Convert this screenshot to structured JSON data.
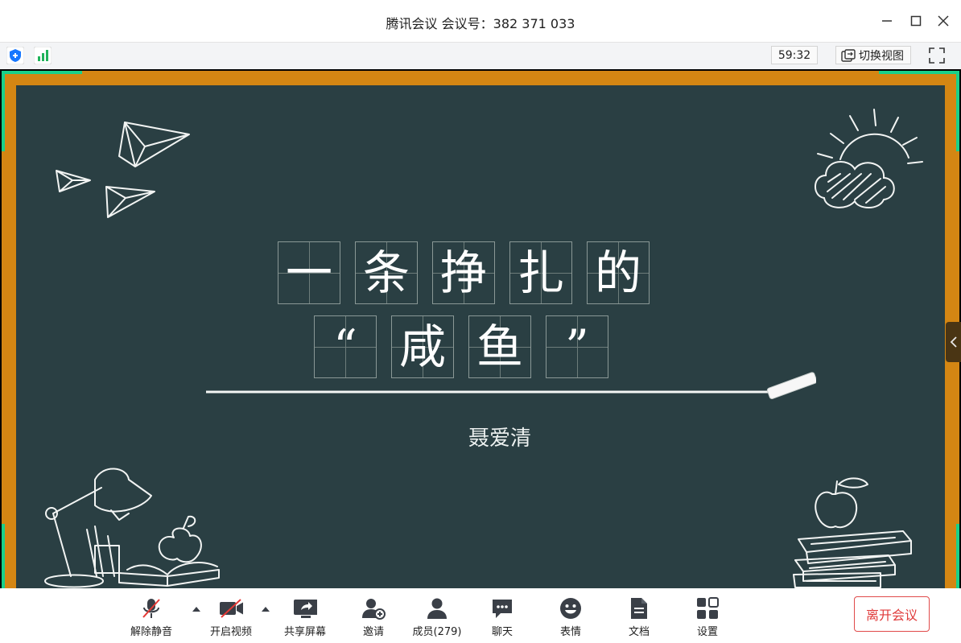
{
  "window": {
    "title": "腾讯会议 会议号：382 371 033"
  },
  "status": {
    "timer": "59:32",
    "switch_view_label": "切换视图"
  },
  "slide": {
    "title_line1": [
      "一",
      "条",
      "挣",
      "扎",
      "的"
    ],
    "title_line2": [
      "“",
      "咸",
      "鱼",
      "”"
    ],
    "author": "聂爱清"
  },
  "toolbar": {
    "unmute": "解除静音",
    "start_video": "开启视频",
    "share_screen": "共享屏幕",
    "invite": "邀请",
    "members": "成员(279)",
    "chat": "聊天",
    "reactions": "表情",
    "docs": "文档",
    "settings": "设置",
    "leave": "离开会议"
  },
  "colors": {
    "board": "#2a3f43",
    "frame": "#d48613",
    "accent_green": "#19d08a",
    "leave_red": "#e03b3b",
    "icon_dark": "#3a3f47"
  }
}
